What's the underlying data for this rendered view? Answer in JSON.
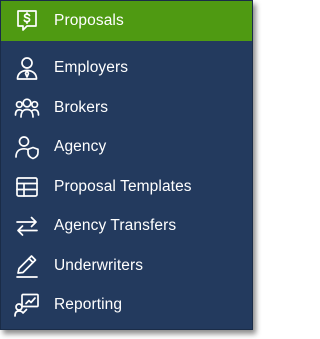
{
  "menu": {
    "items": [
      {
        "label": "Proposals",
        "icon": "dollar-chat-icon",
        "active": true
      },
      {
        "label": "Employers",
        "icon": "person-tie-icon",
        "active": false
      },
      {
        "label": "Brokers",
        "icon": "group-icon",
        "active": false
      },
      {
        "label": "Agency",
        "icon": "person-shield-icon",
        "active": false
      },
      {
        "label": "Proposal Templates",
        "icon": "table-icon",
        "active": false
      },
      {
        "label": "Agency Transfers",
        "icon": "transfer-arrows-icon",
        "active": false
      },
      {
        "label": "Underwriters",
        "icon": "pen-icon",
        "active": false
      },
      {
        "label": "Reporting",
        "icon": "presenter-chart-icon",
        "active": false
      }
    ]
  },
  "colors": {
    "background": "#233a5e",
    "active": "#4f9a12",
    "text": "#ffffff"
  }
}
